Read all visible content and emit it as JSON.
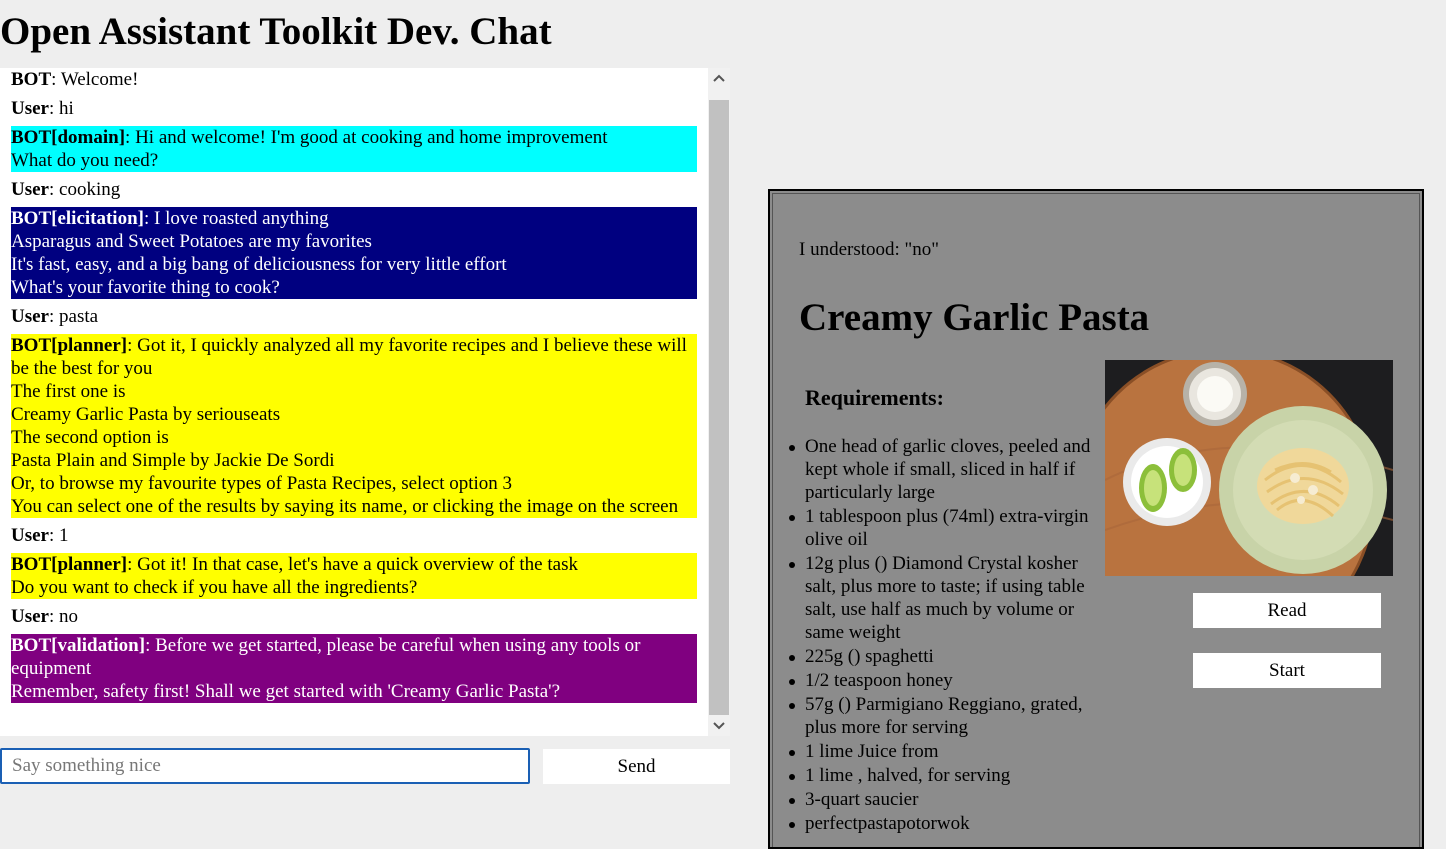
{
  "app": {
    "title": "Open Assistant Toolkit Dev. Chat"
  },
  "chat": {
    "messages": [
      {
        "speaker": "BOT",
        "text": "Welcome!",
        "style": "bot"
      },
      {
        "speaker": "User",
        "text": "hi",
        "style": "user"
      },
      {
        "speaker": "BOT[domain]",
        "text": "Hi and welcome! I'm good at cooking and home improvement\nWhat do you need?",
        "style": "domain"
      },
      {
        "speaker": "User",
        "text": "cooking",
        "style": "user"
      },
      {
        "speaker": "BOT[elicitation]",
        "text": "I love roasted anything\nAsparagus and Sweet Potatoes are my favorites\nIt's fast, easy, and a big bang of deliciousness for very little effort\nWhat's your favorite thing to cook?",
        "style": "elicitation"
      },
      {
        "speaker": "User",
        "text": "pasta",
        "style": "user"
      },
      {
        "speaker": "BOT[planner]",
        "text": "Got it, I quickly analyzed all my favorite recipes and I believe these will be the best for you\nThe first one is\nCreamy Garlic Pasta by seriouseats\nThe second option is\nPasta Plain and Simple by Jackie De Sordi\nOr, to browse my favourite types of Pasta Recipes, select option 3\nYou can select one of the results by saying its name, or clicking the image on the screen",
        "style": "planner"
      },
      {
        "speaker": "User",
        "text": "1",
        "style": "user"
      },
      {
        "speaker": "BOT[planner]",
        "text": "Got it! In that case, let's have a quick overview of the task\nDo you want to check if you have all the ingredients?",
        "style": "planner"
      },
      {
        "speaker": "User",
        "text": "no",
        "style": "user"
      },
      {
        "speaker": "BOT[validation]",
        "text": "Before we get started, please be careful when using any tools or equipment\nRemember, safety first! Shall we get started with 'Creamy Garlic Pasta'?",
        "style": "validation"
      }
    ],
    "colors": {
      "domain": "#00ffff",
      "elicitation": "#000080",
      "planner": "#ffff00",
      "validation": "#800080"
    },
    "input": {
      "placeholder": "Say something nice",
      "value": ""
    },
    "send_label": "Send",
    "scrollbar": {
      "up_icon": "chevron-up-icon",
      "down_icon": "chevron-down-icon"
    }
  },
  "recipe": {
    "understood": "I understood: \"no\"",
    "title": "Creamy Garlic Pasta",
    "requirements_heading": "Requirements:",
    "ingredients": [
      "One head of garlic cloves, peeled and kept whole if small, sliced in half if particularly large",
      "1 tablespoon plus (74ml) extra-virgin olive oil",
      "12g plus () Diamond Crystal kosher salt, plus more to taste; if using table salt, use half as much by volume or same weight",
      "225g () spaghetti",
      "1/2 teaspoon honey",
      "57g () Parmigiano Reggiano, grated, plus more for serving",
      "1 lime Juice from",
      "1 lime , halved, for serving",
      "3-quart saucier",
      "perfectpastapotorwok"
    ],
    "read_label": "Read",
    "start_label": "Start"
  }
}
